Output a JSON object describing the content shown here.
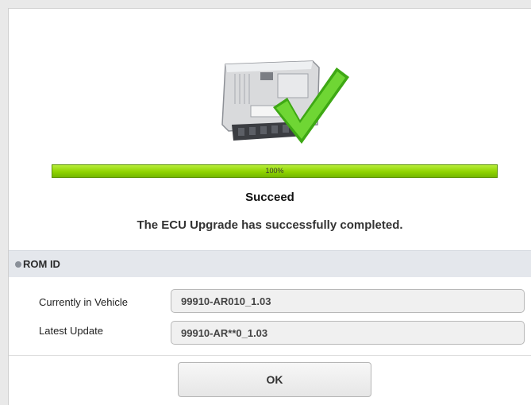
{
  "progress": {
    "label": "100%",
    "percent": 100
  },
  "status": {
    "title": "Succeed",
    "message": "The ECU Upgrade has successfully completed."
  },
  "rom_section": {
    "header": "ROM ID",
    "rows": [
      {
        "label": "Currently in Vehicle",
        "value": "99910-AR010_1.03"
      },
      {
        "label": "Latest Update",
        "value": "99910-AR**0_1.03"
      }
    ]
  },
  "buttons": {
    "ok": "OK"
  },
  "icons": {
    "ecu": "ecu-module-icon",
    "check": "checkmark-icon",
    "bullet": "bullet-icon"
  },
  "colors": {
    "progress": "#8fd400",
    "check": "#4cc21b",
    "section_bg": "#e4e7ec"
  }
}
